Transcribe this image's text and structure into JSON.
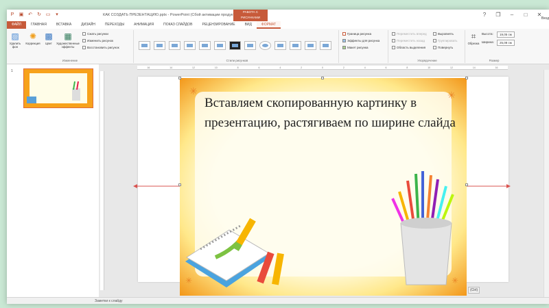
{
  "titlebar": {
    "doc_title": "КАК СОЗДАТЬ ПРЕЗЕНТАЦИЮ.pptx - PowerPoint (Сбой активации продукта)",
    "context_tab_group": "РАБОТА С РИСУНКАМИ",
    "help": "?",
    "restore": "❐",
    "minimize": "–",
    "maximize": "□",
    "close": "✕",
    "user": "Вход"
  },
  "tabs": [
    "ФАЙЛ",
    "ГЛАВНАЯ",
    "ВСТАВКА",
    "ДИЗАЙН",
    "ПЕРЕХОДЫ",
    "АНИМАЦИЯ",
    "ПОКАЗ СЛАЙДОВ",
    "РЕЦЕНЗИРОВАНИЕ",
    "ВИД",
    "ФОРМАТ"
  ],
  "ribbon": {
    "adjust": {
      "remove_bg": "Удалить фон",
      "corrections": "Коррекция",
      "color": "Цвет",
      "artistic": "Художественные эффекты",
      "compress": "Сжать рисунки",
      "change": "Изменить рисунок",
      "reset": "Восстановить рисунок",
      "label": "Изменение"
    },
    "styles": {
      "label": "Стили рисунков",
      "border": "Граница рисунка",
      "effects": "Эффекты для рисунка",
      "layout": "Макет рисунка"
    },
    "arrange": {
      "bring_forward": "Переместить вперед",
      "send_backward": "Переместить назад",
      "selection_pane": "Область выделения",
      "align": "Выровнять",
      "group": "Группировать",
      "rotate": "Повернуть",
      "label": "Упорядочение"
    },
    "size": {
      "crop": "Обрезка",
      "height_label": "Высота:",
      "height_value": "19,05 см",
      "width_label": "Ширина:",
      "width_value": "25,08 см",
      "label": "Размер"
    }
  },
  "thumbs": {
    "slide_number": "1"
  },
  "ruler_ticks": [
    "16",
    "14",
    "12",
    "10",
    "8",
    "6",
    "4",
    "2",
    "0",
    "2",
    "4",
    "6",
    "8",
    "10",
    "12",
    "14",
    "16"
  ],
  "slide": {
    "text": "Вставляем скопированную картинку в презентацию, растягиваем по ширине слайда"
  },
  "paste_options": "(Ctrl)",
  "statusbar": {
    "notes": "Заметки к слайду"
  },
  "colors": {
    "accent": "#c75a3a",
    "frame_orange": "#f39a1e",
    "arrow_red": "#d9534f"
  }
}
